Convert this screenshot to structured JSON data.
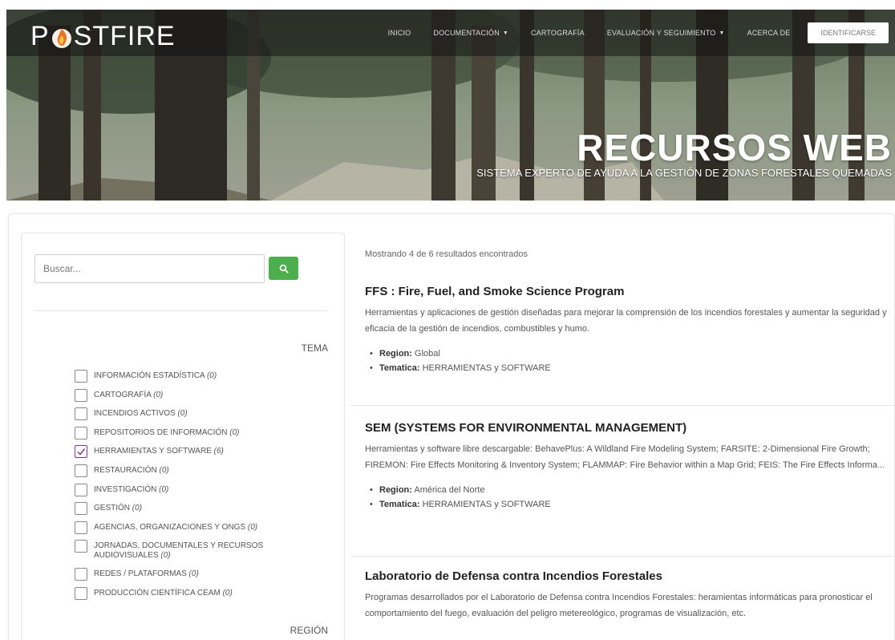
{
  "header": {
    "logo_text_before": "P",
    "logo_text_after": "STFIRE",
    "nav": [
      {
        "label": "INICIO",
        "dropdown": false
      },
      {
        "label": "DOCUMENTACIÓN",
        "dropdown": true
      },
      {
        "label": "CARTOGRAFÍA",
        "dropdown": false
      },
      {
        "label": "EVALUACIÓN Y SEGUIMIENTO",
        "dropdown": true
      },
      {
        "label": "ACERCA DE",
        "dropdown": false
      }
    ],
    "login_label": "IDENTIFICARSE"
  },
  "hero": {
    "title": "RECURSOS WEB",
    "subtitle": "SISTEMA EXPERTO DE AYUDA A LA GESTIÓN DE ZONAS FORESTALES QUEMADAS"
  },
  "sidebar": {
    "search_placeholder": "Buscar...",
    "tema_label": "TEMA",
    "region_label": "REGIÓN",
    "filters": [
      {
        "label": "INFORMACIÓN ESTADÍSTICA",
        "count": "(0)",
        "checked": false
      },
      {
        "label": "CARTOGRAFÍA",
        "count": "(0)",
        "checked": false
      },
      {
        "label": "INCENDIOS ACTIVOS",
        "count": "(0)",
        "checked": false
      },
      {
        "label": "REPOSITORIOS DE INFORMACIÓN",
        "count": "(0)",
        "checked": false
      },
      {
        "label": "HERRAMIENTAS y SOFTWARE",
        "count": "(6)",
        "checked": true
      },
      {
        "label": "RESTAURACIÓN",
        "count": "(0)",
        "checked": false
      },
      {
        "label": "INVESTIGACIÓN",
        "count": "(0)",
        "checked": false
      },
      {
        "label": "GESTIÓN",
        "count": "(0)",
        "checked": false
      },
      {
        "label": "AGENCIAS, ORGANIZACIONES Y ONGs",
        "count": "(0)",
        "checked": false
      },
      {
        "label": "JORNADAS, DOCUMENTALES Y RECURSOS AUDIOVISUALES",
        "count": "(0)",
        "checked": false
      },
      {
        "label": "REDES / PLATAFORMAS",
        "count": "(0)",
        "checked": false
      },
      {
        "label": "PRODUCCIÓN CIENTÍFICA CEAM",
        "count": "(0)",
        "checked": false
      }
    ]
  },
  "results": {
    "count_text": "Mostrando 4 de 6 resultados encontrados",
    "region_key": "Region:",
    "tematica_key": "Tematica:",
    "items": [
      {
        "title": "FFS : Fire, Fuel, and Smoke Science Program",
        "description": "Herramientas y aplicaciones de gestión diseñadas para mejorar la comprensión de los incendios forestales y aumentar la seguridad y eficacia de la gestión de incendios, combustibles y humo.",
        "region": "Global",
        "tematica": "HERRAMIENTAS y SOFTWARE"
      },
      {
        "title": "SEM (SYSTEMS FOR ENVIRONMENTAL MANAGEMENT)",
        "description": "Herramientas y software libre descargable: BehavePlus: A Wildland Fire Modeling System; FARSITE: 2-Dimensional Fire Growth; FIREMON: Fire Effects Monitoring & Inventory System; FLAMMAP: Fire Behavior within a Map Grid;  FEIS: The Fire Effects Informa...",
        "region": "América del Norte",
        "tematica": "HERRAMIENTAS y SOFTWARE"
      },
      {
        "title": "Laboratorio de Defensa contra Incendios Forestales",
        "description": "Programas desarrollados por el Laboratorio de Defensa contra Incendios Forestales: heramientas informáticas para pronosticar el comportamiento del fuego, evaluación del peligro metereológico, programas de visualización, etc.",
        "region": "",
        "tematica": ""
      }
    ]
  },
  "colors": {
    "search_button": "#4cae4c",
    "checkbox_check": "#7a3d8f",
    "logo_flame": "#e8742a"
  }
}
